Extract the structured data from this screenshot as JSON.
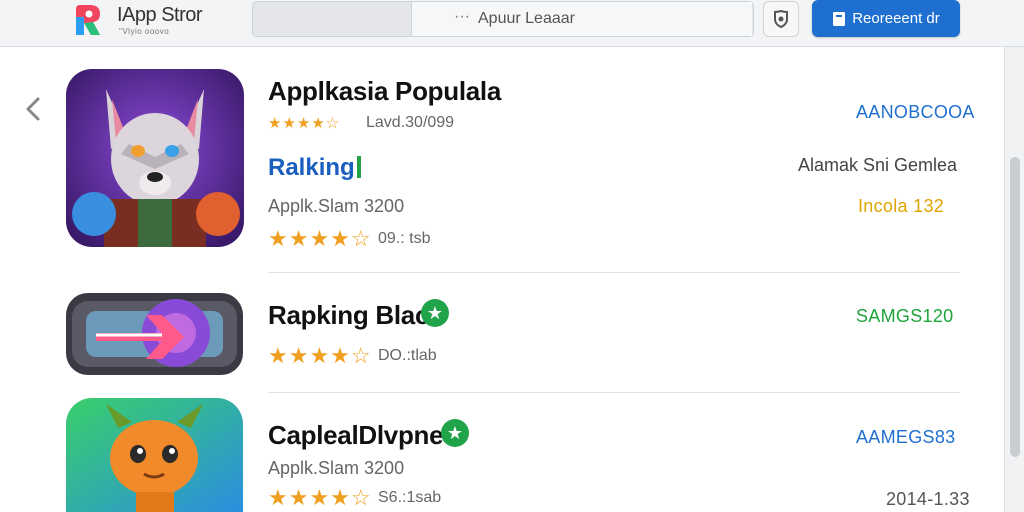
{
  "header": {
    "brand": "IApp Stror",
    "brand_sub": "\"Vlyio ooovo",
    "search_dots": "···",
    "search_placeholder": "Apuur Leaaar",
    "primary_button": "Reoreeent dr"
  },
  "colors": {
    "accent": "#1f6fd0",
    "price_blue": "#1f6fd0",
    "price_green": "#1fa33a",
    "price_gold": "#e0a400",
    "star": "#f0a020",
    "badge_green": "#21a34a"
  },
  "icons": {
    "logo": "app-store-logo",
    "back": "chevron-left-icon",
    "settings": "shield-icon",
    "button": "bookmark-icon",
    "badge": "star-badge-icon"
  },
  "apps": [
    {
      "title": "Applkasia Populala",
      "stars": "★★★★☆",
      "rating_text": "Lavd.30/099",
      "ranking": "Ralking",
      "developer": "Applk.Slam 3200",
      "stars2": "★★★★☆",
      "reviews": "09.: tsb",
      "price": "AANOBCOOA",
      "category": "Alamak Sni Gemlea",
      "meta_right": "Incola 132"
    },
    {
      "title": "Rapking Blac",
      "stars": "★★★★☆",
      "reviews": "DO.:tlab",
      "price": "SAMGS120"
    },
    {
      "title": "CaplealDlvpne",
      "developer": "Applk.Slam 3200",
      "stars": "★★★★☆",
      "reviews": "S6.:1sab",
      "price": "AAMEGS83",
      "meta_right": "2014-1.33"
    }
  ]
}
